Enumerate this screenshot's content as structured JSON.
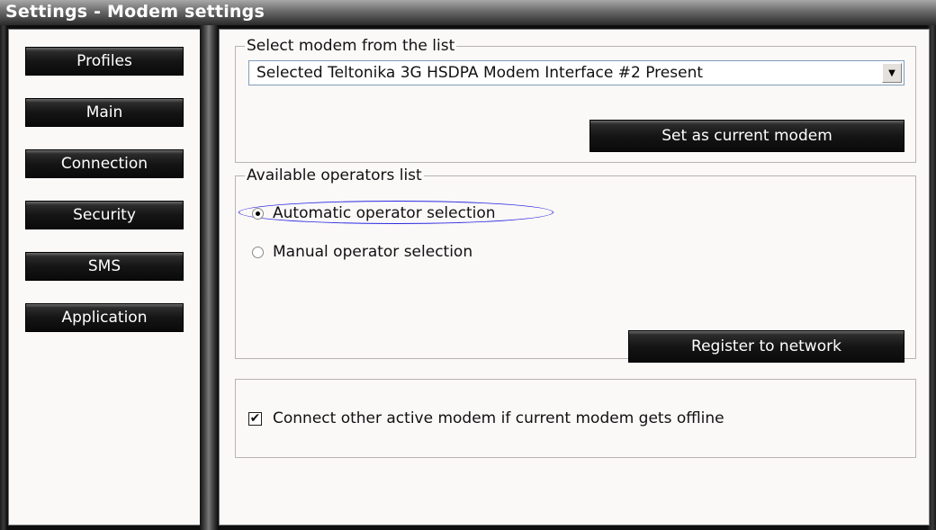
{
  "window": {
    "title": "Settings - Modem settings"
  },
  "sidebar": {
    "items": [
      {
        "label": "Profiles"
      },
      {
        "label": "Main"
      },
      {
        "label": "Connection"
      },
      {
        "label": "Security"
      },
      {
        "label": "SMS"
      },
      {
        "label": "Application"
      }
    ]
  },
  "modem_group": {
    "legend": "Select modem from the list",
    "selected_value": "Selected  Teltonika 3G HSDPA Modem Interface #2  Present",
    "dropdown_icon": "chevron-down-icon",
    "set_current_label": "Set as current modem"
  },
  "operators_group": {
    "legend": "Available operators list",
    "automatic_label": "Automatic operator selection",
    "automatic_selected": true,
    "manual_label": "Manual operator selection",
    "manual_selected": false,
    "register_label": "Register to network",
    "highlight_color": "#2a2ae0"
  },
  "options_group": {
    "connect_other_label": "Connect other active modem if current modem gets offline",
    "connect_other_checked": true,
    "check_glyph": "✔"
  }
}
